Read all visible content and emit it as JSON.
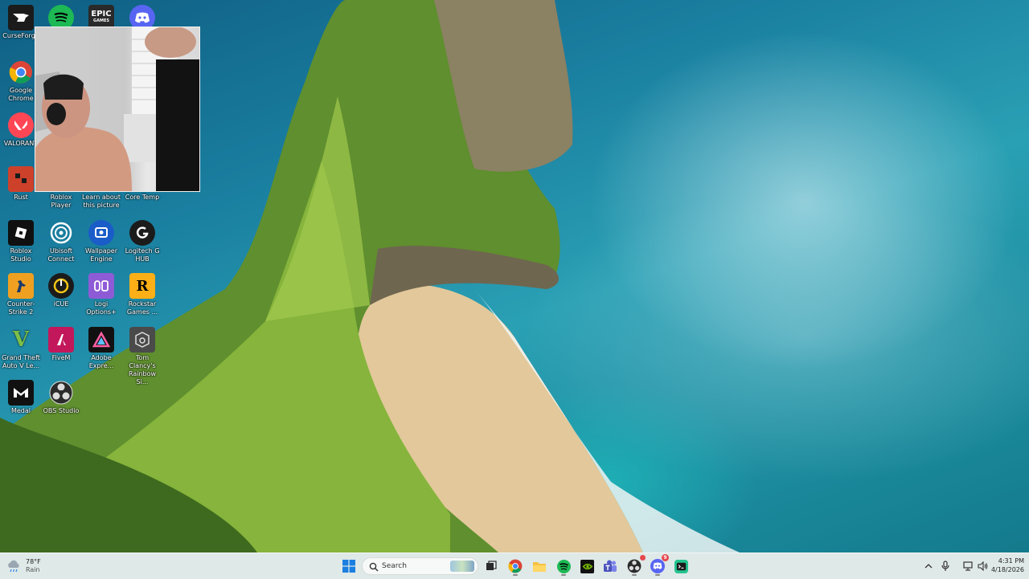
{
  "desktop": {
    "icons": [
      {
        "label": "CurseForge",
        "icon": "curseforge-icon"
      },
      {
        "label": "",
        "icon": "spotify-icon"
      },
      {
        "label": "",
        "icon": "epic-games-icon",
        "mark": "EPIC\nGAMES"
      },
      {
        "label": "",
        "icon": "discord-icon"
      },
      {
        "label": "Google Chrome",
        "icon": "chrome-icon"
      },
      {
        "label": "VALORANT",
        "icon": "valorant-icon"
      },
      {
        "label": "Rust",
        "icon": "rust-icon"
      },
      {
        "label": "Roblox Player",
        "icon": "roblox-player-icon"
      },
      {
        "label": "Learn about this picture",
        "icon": "learn-about-picture-icon"
      },
      {
        "label": "Core Temp",
        "icon": "core-temp-icon"
      },
      {
        "label": "Roblox Studio",
        "icon": "roblox-studio-icon"
      },
      {
        "label": "Ubisoft Connect",
        "icon": "ubisoft-connect-icon"
      },
      {
        "label": "Wallpaper Engine",
        "icon": "wallpaper-engine-icon"
      },
      {
        "label": "Logitech G HUB",
        "icon": "logitech-g-hub-icon"
      },
      {
        "label": "Counter-Strike 2",
        "icon": "counter-strike-2-icon"
      },
      {
        "label": "iCUE",
        "icon": "icue-icon"
      },
      {
        "label": "Logi Options+",
        "icon": "logi-options-icon"
      },
      {
        "label": "Rockstar Games ...",
        "icon": "rockstar-games-icon"
      },
      {
        "label": "Grand Theft Auto V Le...",
        "icon": "gta-v-icon"
      },
      {
        "label": "FiveM",
        "icon": "fivem-icon"
      },
      {
        "label": "Adobe Expre...",
        "icon": "adobe-express-icon"
      },
      {
        "label": "Tom Clancy's Rainbow Si...",
        "icon": "rainbow-six-siege-icon"
      },
      {
        "label": "Medal",
        "icon": "medal-icon"
      },
      {
        "label": "OBS Studio",
        "icon": "obs-studio-icon"
      }
    ]
  },
  "taskbar": {
    "weather": {
      "temp": "78°F",
      "condition": "Rain",
      "icon": "rain-cloud-icon"
    },
    "search": {
      "placeholder": "Search",
      "icon": "search-icon"
    },
    "pinned": [
      {
        "name": "start",
        "icon": "windows-start-icon"
      },
      {
        "name": "task-view",
        "icon": "task-view-icon"
      },
      {
        "name": "chrome",
        "icon": "chrome-icon"
      },
      {
        "name": "file-explorer",
        "icon": "folder-icon"
      },
      {
        "name": "spotify",
        "icon": "spotify-icon"
      },
      {
        "name": "nvidia",
        "icon": "nvidia-icon"
      },
      {
        "name": "teams",
        "icon": "teams-icon"
      },
      {
        "name": "obs",
        "icon": "obs-icon"
      },
      {
        "name": "discord",
        "icon": "discord-icon",
        "badge": "9"
      },
      {
        "name": "terminal",
        "icon": "terminal-icon"
      }
    ],
    "tray": {
      "icons": [
        "chevron-up-icon",
        "microphone-icon",
        "network-icon",
        "volume-icon"
      ]
    },
    "clock": {
      "time": "4:31 PM",
      "date": "4/18/2026"
    }
  },
  "colors": {
    "taskbar_bg": "#e8eeec",
    "windows_blue": "#0f6cbd",
    "discord": "#5865f2",
    "spotify": "#1db954"
  }
}
